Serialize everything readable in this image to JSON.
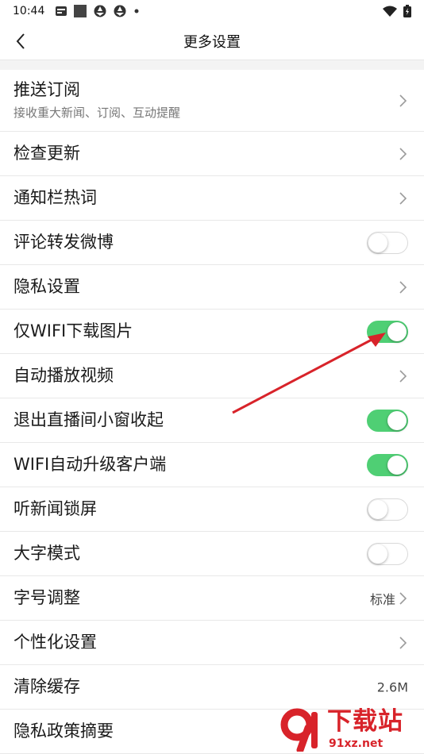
{
  "status_bar": {
    "time": "10:44",
    "left_icons": [
      "news-app-icon",
      "square-app-icon",
      "aperture-icon",
      "aperture-icon",
      "dot-icon"
    ],
    "right_icons": [
      "wifi-icon",
      "battery-icon"
    ]
  },
  "nav": {
    "title": "更多设置",
    "back_icon": "chevron-left-icon"
  },
  "settings": [
    {
      "id": "push",
      "label": "推送订阅",
      "sub": "接收重大新闻、订阅、互动提醒",
      "control": "chevron"
    },
    {
      "id": "update",
      "label": "检查更新",
      "control": "chevron"
    },
    {
      "id": "notify-hotwords",
      "label": "通知栏热词",
      "control": "chevron"
    },
    {
      "id": "comment-weibo",
      "label": "评论转发微博",
      "control": "toggle",
      "on": false
    },
    {
      "id": "privacy",
      "label": "隐私设置",
      "control": "chevron"
    },
    {
      "id": "wifi-images",
      "label": "仅WIFI下载图片",
      "control": "toggle",
      "on": true
    },
    {
      "id": "autoplay",
      "label": "自动播放视频",
      "control": "chevron"
    },
    {
      "id": "live-mini",
      "label": "退出直播间小窗收起",
      "control": "toggle",
      "on": true
    },
    {
      "id": "wifi-upgrade",
      "label": "WIFI自动升级客户端",
      "control": "toggle",
      "on": true
    },
    {
      "id": "lockscreen",
      "label": "听新闻锁屏",
      "control": "toggle",
      "on": false
    },
    {
      "id": "bigfont",
      "label": "大字模式",
      "control": "toggle",
      "on": false
    },
    {
      "id": "fontsize",
      "label": "字号调整",
      "control": "chevron",
      "value": "标准"
    },
    {
      "id": "personalize",
      "label": "个性化设置",
      "control": "chevron"
    },
    {
      "id": "cache",
      "label": "清除缓存",
      "control": "value",
      "value": "2.6M"
    },
    {
      "id": "privacy-summary",
      "label": "隐私政策摘要",
      "control": "none"
    }
  ],
  "colors": {
    "toggle_on": "#4fcf74",
    "arrow": "#d8232a",
    "watermark": "#d8232a"
  },
  "watermark": {
    "logo_text": "9",
    "brand": "下载站",
    "site": "91xz.net"
  }
}
